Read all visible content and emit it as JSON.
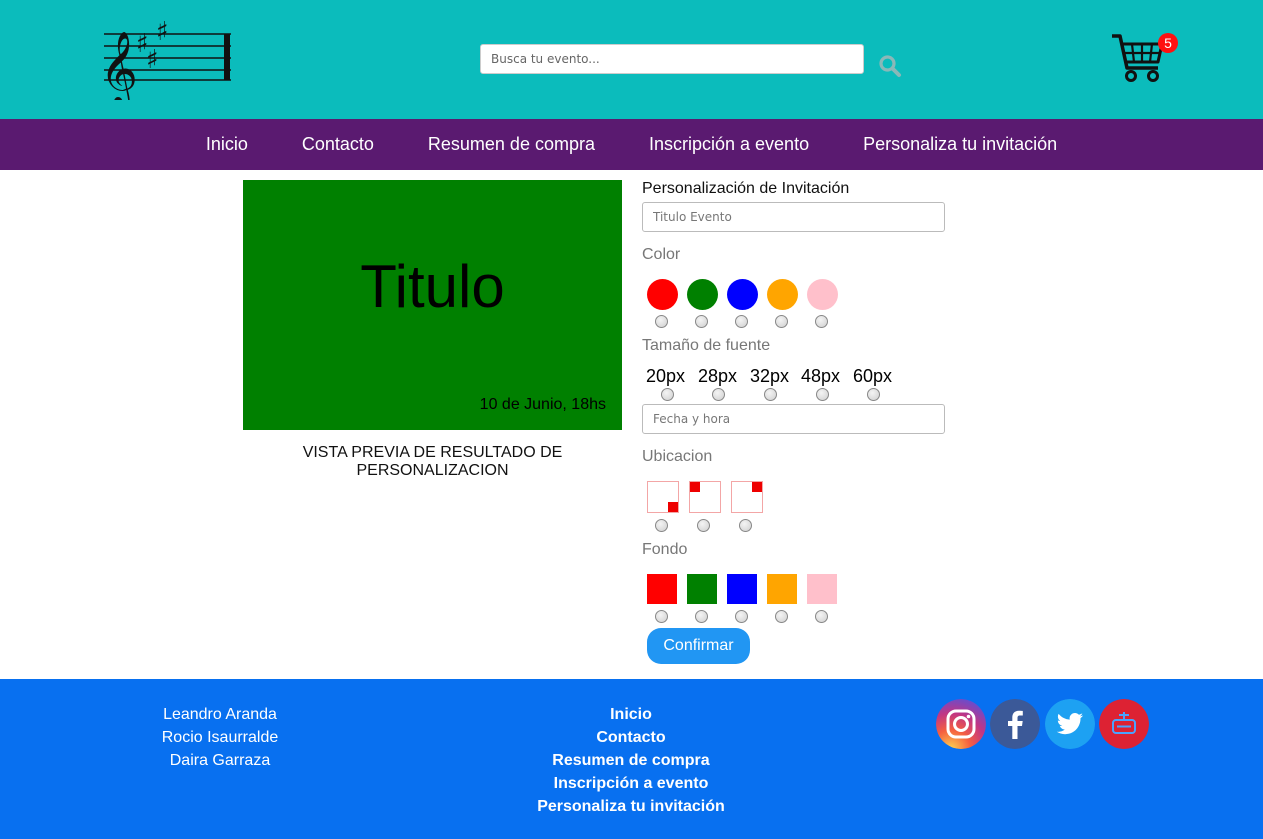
{
  "header": {
    "search_placeholder": "Busca tu evento...",
    "cart_count": "5"
  },
  "nav": {
    "items": [
      "Inicio",
      "Contacto",
      "Resumen de compra",
      "Inscripción a evento",
      "Personaliza tu invitación"
    ]
  },
  "preview": {
    "title": "Titulo",
    "date": "10 de Junio, 18hs",
    "background_color": "#008000",
    "caption_line1": "VISTA PREVIA DE RESULTADO DE",
    "caption_line2": "PERSONALIZACION"
  },
  "form": {
    "heading": "Personalización de Invitación",
    "title_placeholder": "Titulo Evento",
    "color_label": "Color",
    "colors": [
      "#ff0000",
      "#008000",
      "#0000ff",
      "#ffa500",
      "#ffc0cb"
    ],
    "font_size_label": "Tamaño de fuente",
    "font_sizes": [
      "20px",
      "28px",
      "32px",
      "48px",
      "60px"
    ],
    "date_placeholder": "Fecha y hora",
    "location_label": "Ubicacion",
    "background_label": "Fondo",
    "backgrounds": [
      "#ff0000",
      "#008000",
      "#0000ff",
      "#ffa500",
      "#ffc0cb"
    ],
    "confirm_label": "Confirmar"
  },
  "footer": {
    "authors": [
      "Leandro Aranda",
      "Rocio Isaurralde",
      "Daira Garraza"
    ],
    "links": [
      "Inicio",
      "Contacto",
      "Resumen de compra",
      "Inscripción a evento",
      "Personaliza tu invitación"
    ],
    "social_icons": [
      "instagram-icon",
      "facebook-icon",
      "twitter-icon",
      "youtube-icon"
    ]
  }
}
